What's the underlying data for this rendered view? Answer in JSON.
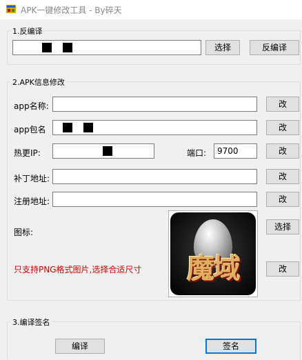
{
  "window": {
    "title": "APK一键修改工具  - By碎天"
  },
  "decompile": {
    "group_title": "1.反编译",
    "path_value": "",
    "select_label": "选择",
    "decompile_label": "反编译"
  },
  "apk_info": {
    "group_title": "2.APK信息修改",
    "app_name_label": "app名称:",
    "app_name_value": "",
    "package_label": "app包名",
    "package_value": "",
    "hot_update_ip_label": "热更IP:",
    "hot_update_ip_value": "",
    "port_label": "端口:",
    "port_value": "9700",
    "patch_url_label": "补丁地址:",
    "patch_url_value": "",
    "register_url_label": "注册地址:",
    "register_url_value": "",
    "icon_label": "图标:",
    "icon_note": "只支持PNG格式图片,选择合适尺寸",
    "icon_brand_text": "魔域",
    "modify_label": "改",
    "select_icon_label": "选择"
  },
  "build": {
    "group_title": "3.编译签名",
    "compile_label": "编译",
    "sign_label": "签名"
  },
  "colors": {
    "note_red": "#d40000",
    "focus_blue": "#0078d7"
  }
}
